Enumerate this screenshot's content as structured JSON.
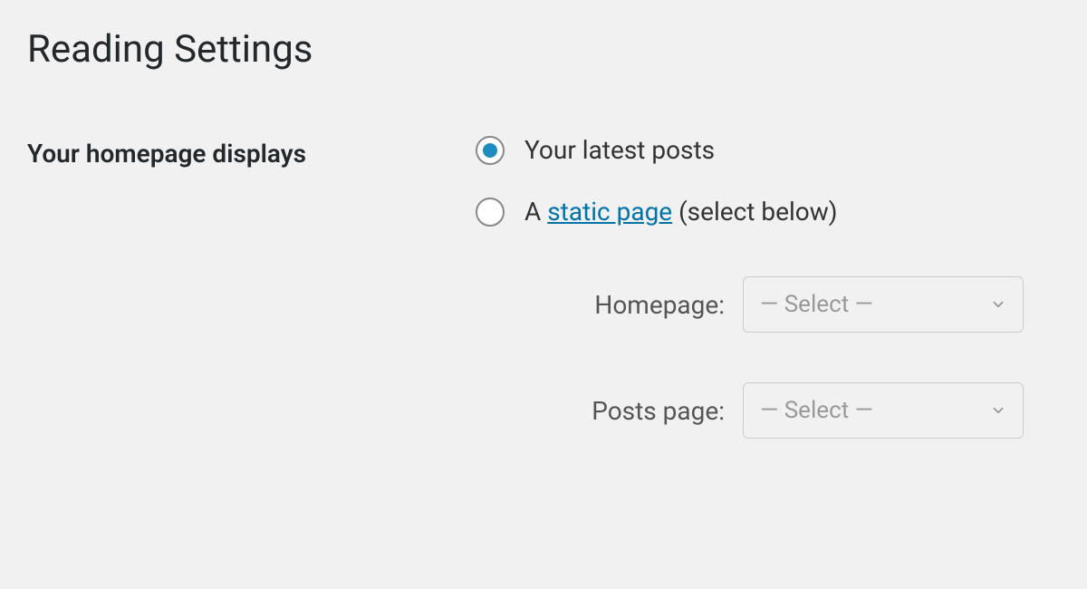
{
  "page": {
    "title": "Reading Settings"
  },
  "form": {
    "homepage_displays": {
      "label": "Your homepage displays",
      "options": {
        "latest_posts": {
          "label": "Your latest posts",
          "selected": true
        },
        "static_page": {
          "prefix": "A ",
          "link_text": "static page",
          "suffix": " (select below)",
          "selected": false
        }
      }
    },
    "homepage_select": {
      "label": "Homepage:",
      "placeholder": "— Select —"
    },
    "posts_page_select": {
      "label": "Posts page:",
      "placeholder": "— Select —"
    }
  }
}
